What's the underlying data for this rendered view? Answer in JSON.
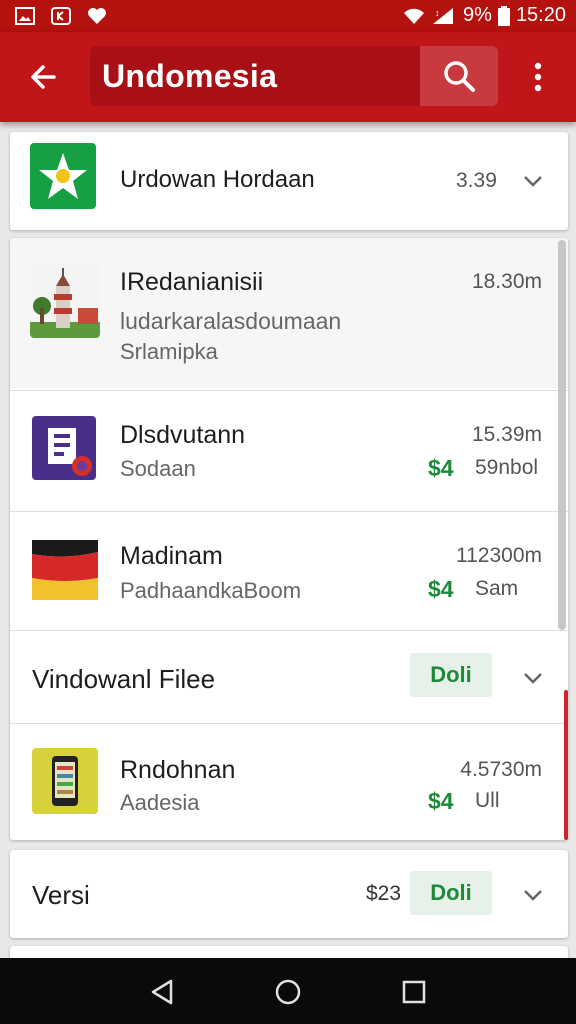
{
  "status_bar": {
    "battery": "9%",
    "time": "15:20",
    "icons": [
      "image-icon",
      "camera-icon",
      "heart-icon",
      "wifi-icon",
      "signal-icon",
      "battery-icon"
    ]
  },
  "app_bar": {
    "search_text": "Undomesia",
    "icons": [
      "back-arrow-icon",
      "search-icon",
      "more-vert-icon"
    ]
  },
  "colors": {
    "app_bar": "#c0161a",
    "status_bar": "#b3120f",
    "price_green": "#1d8a3a",
    "scroll_accent": "#c9272b"
  },
  "header_card": {
    "title": "Urdowan Hordaan",
    "value": "3.39"
  },
  "list": [
    {
      "title": "IRedanianisii",
      "subtitle": "ludarkaralasdoumaan",
      "subtitle2": "Srlamipka",
      "meta": "18.30m"
    },
    {
      "title": "Dlsdvutann",
      "subtitle": "Sodaan",
      "meta": "15.39m",
      "price": "$4",
      "price_tail": "59nbol"
    },
    {
      "title": "Madinam",
      "subtitle": "PadhaandkaBoom",
      "meta": "112300m",
      "price": "$4",
      "price_tail": "Sam"
    }
  ],
  "section_files": {
    "title": "Vindowanl Filee",
    "badge": "Doli"
  },
  "files_item": {
    "title": "Rndohnan",
    "subtitle": "Aadesia",
    "meta": "4.5730m",
    "price": "$4",
    "price_tail": "Ull"
  },
  "section_versi": {
    "title": "Versi",
    "price": "$23",
    "badge": "Doli"
  },
  "nav_bar": {
    "icons": [
      "nav-back-icon",
      "nav-home-icon",
      "nav-recents-icon"
    ]
  }
}
